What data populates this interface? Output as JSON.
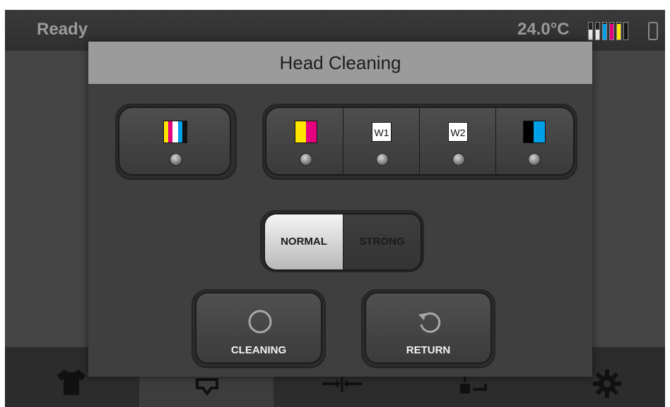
{
  "status_bar": {
    "status": "Ready",
    "temperature": "24.0°C",
    "ink_levels": [
      {
        "color": "#e8e8e8",
        "level": 0.6
      },
      {
        "color": "#e8e8e8",
        "level": 0.6
      },
      {
        "color": "#00a0e9",
        "level": 0.9
      },
      {
        "color": "#e4007f",
        "level": 0.9
      },
      {
        "color": "#ffe600",
        "level": 0.9
      },
      {
        "color": "#111111",
        "level": 0.9
      }
    ]
  },
  "dialog": {
    "title": "Head Cleaning",
    "all_heads_icon": "cmyk-white-icon",
    "heads": [
      {
        "id": "cmy",
        "icon": "yellow-magenta-icon"
      },
      {
        "id": "w1",
        "label": "W1"
      },
      {
        "id": "w2",
        "label": "W2"
      },
      {
        "id": "kc",
        "icon": "black-cyan-icon"
      }
    ],
    "mode": {
      "options": [
        "NORMAL",
        "STRONG"
      ],
      "selected": "NORMAL"
    },
    "cleaning_label": "CLEANING",
    "return_label": "RETURN"
  },
  "colors": {
    "white_ink": "#ffffff",
    "cyan": "#00a0e9",
    "magenta": "#e4007f",
    "yellow": "#ffe600",
    "black": "#000000"
  },
  "bottom_nav": {
    "icons": [
      "tshirt-icon",
      "printhead-icon",
      "align-icon",
      "maintenance-icon",
      "gear-icon"
    ],
    "active": "printhead-icon"
  }
}
